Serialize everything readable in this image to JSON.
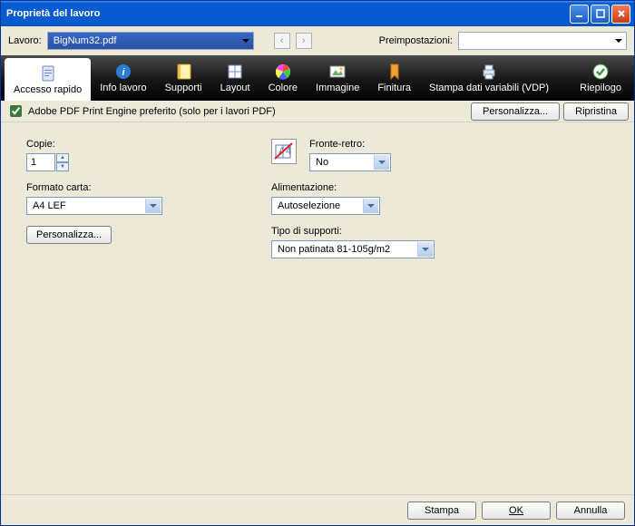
{
  "window": {
    "title": "Proprietà del lavoro"
  },
  "toprow": {
    "job_label": "Lavoro:",
    "job_value": "BigNum32.pdf",
    "preset_label": "Preimpostazioni:",
    "preset_value": ""
  },
  "tabs": [
    {
      "key": "quick",
      "label": "Accesso rapido",
      "selected": true
    },
    {
      "key": "info",
      "label": "Info lavoro",
      "selected": false
    },
    {
      "key": "media",
      "label": "Supporti",
      "selected": false
    },
    {
      "key": "layout",
      "label": "Layout",
      "selected": false
    },
    {
      "key": "color",
      "label": "Colore",
      "selected": false
    },
    {
      "key": "image",
      "label": "Immagine",
      "selected": false
    },
    {
      "key": "finish",
      "label": "Finitura",
      "selected": false
    },
    {
      "key": "vdp",
      "label": "Stampa dati variabili (VDP)",
      "selected": false
    },
    {
      "key": "summary",
      "label": "Riepilogo",
      "selected": false
    }
  ],
  "toolbar2": {
    "appe_label": "Adobe PDF Print Engine preferito (solo per i lavori PDF)",
    "appe_checked": true,
    "customize": "Personalizza...",
    "reset": "Ripristina"
  },
  "form": {
    "copies_label": "Copie:",
    "copies_value": "1",
    "paper_label": "Formato carta:",
    "paper_value": "A4 LEF",
    "paper_customize": "Personalizza...",
    "duplex_label": "Fronte-retro:",
    "duplex_value": "No",
    "feed_label": "Alimentazione:",
    "feed_value": "Autoselezione",
    "media_label": "Tipo di supporti:",
    "media_value": "Non patinata 81-105g/m2"
  },
  "footer": {
    "print": "Stampa",
    "ok": "OK",
    "cancel": "Annulla"
  }
}
